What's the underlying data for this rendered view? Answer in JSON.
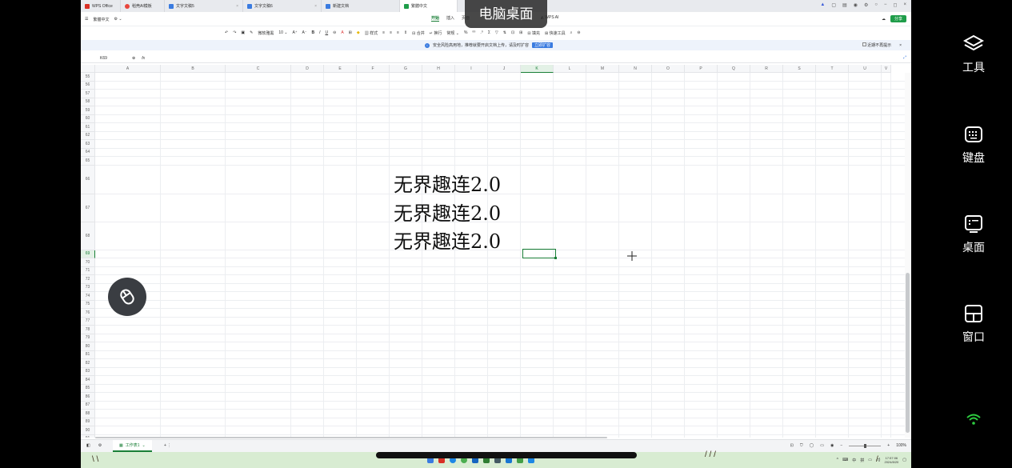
{
  "overlay": {
    "title": "电脑桌面"
  },
  "tabs": [
    {
      "label": "WPS Office",
      "color": "#d93025"
    },
    {
      "label": "稻壳AI模板",
      "color": "#e8453c"
    },
    {
      "label": "文字文稿5",
      "color": "#3a7be0"
    },
    {
      "label": "文字文稿6",
      "color": "#3a7be0"
    },
    {
      "label": "新建文档",
      "color": "#3a7be0"
    },
    {
      "label": "繁體中文",
      "color": "#1f9d4a"
    }
  ],
  "menu": {
    "doc_name": "繁體中文",
    "items": [
      "开始",
      "插入",
      "页面"
    ],
    "wps_ai": "WPS AI",
    "share": "分享"
  },
  "ribbon": {
    "font_name": "微软雅黑",
    "font_size": "10",
    "format_label": "常规",
    "items": [
      "样式",
      "合并",
      "换行",
      "填充",
      "快速工具"
    ]
  },
  "notice": {
    "message": "安全风险高用地，推荐就要开启文档上传，请及时扩容",
    "button": "立即扩容",
    "dont_show": "近期不再提示"
  },
  "formula_bar": {
    "cell_ref": "K69",
    "fx": "fx"
  },
  "grid": {
    "columns": [
      "A",
      "B",
      "C",
      "D",
      "E",
      "F",
      "G",
      "H",
      "I",
      "J",
      "K",
      "L",
      "M",
      "N",
      "O",
      "P",
      "Q",
      "R",
      "S",
      "T",
      "U",
      "V"
    ],
    "selected_column": "K",
    "rows": [
      "55",
      "56",
      "57",
      "58",
      "59",
      "60",
      "61",
      "62",
      "63",
      "64",
      "65",
      "66",
      "67",
      "68",
      "69",
      "70",
      "71",
      "72",
      "73",
      "74",
      "75",
      "76",
      "77",
      "78",
      "79",
      "80",
      "81",
      "82",
      "83",
      "84",
      "85",
      "86",
      "87",
      "88",
      "89",
      "90",
      "91"
    ],
    "selected_row": "69",
    "cell_lines": [
      "无界趣连2.0",
      "无界趣连2.0",
      "无界趣连2.0"
    ]
  },
  "sheets": {
    "active": "工作表1"
  },
  "status": {
    "zoom": "100%"
  },
  "taskbar": {
    "time": "17:57:06",
    "date": "2024/8/20",
    "ime": "中"
  },
  "sidepanel": [
    {
      "label": "工具",
      "icon": "layers-icon"
    },
    {
      "label": "键盘",
      "icon": "keyboard-icon"
    },
    {
      "label": "桌面",
      "icon": "desktop-icon"
    },
    {
      "label": "窗口",
      "icon": "window-icon"
    }
  ],
  "colors": {
    "accent": "#1a7f37",
    "share": "#1f9d4a",
    "notice": "#3a7be0",
    "wifi": "#2ecc40"
  }
}
